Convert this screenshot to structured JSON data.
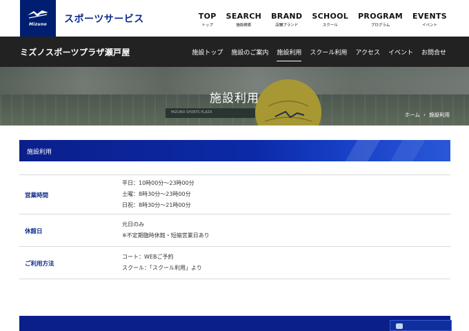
{
  "brand": {
    "logo_text": "Mizuno",
    "service_name": "スポーツサービス"
  },
  "global_nav": [
    {
      "en": "TOP",
      "ja": "トップ"
    },
    {
      "en": "SEARCH",
      "ja": "施設検索"
    },
    {
      "en": "BRAND",
      "ja": "店舗ブランド"
    },
    {
      "en": "SCHOOL",
      "ja": "スクール"
    },
    {
      "en": "PROGRAM",
      "ja": "プログラム"
    },
    {
      "en": "EVENTS",
      "ja": "イベント"
    }
  ],
  "facility_name": "ミズノスポーツプラザ瀬戸屋",
  "sub_nav": [
    {
      "label": "施設トップ"
    },
    {
      "label": "施設のご案内"
    },
    {
      "label": "施設利用",
      "active": true
    },
    {
      "label": "スクール利用"
    },
    {
      "label": "アクセス"
    },
    {
      "label": "イベント"
    },
    {
      "label": "お問合せ"
    }
  ],
  "hero": {
    "title": "施設利用",
    "board_text": "MIZUNO SPORTS PLAZA"
  },
  "breadcrumb": {
    "home": "ホーム",
    "separator": "›",
    "current": "施設利用"
  },
  "section": {
    "title": "施設利用"
  },
  "info_rows": [
    {
      "label": "営業時間",
      "lines": [
        "平日：10時00分〜23時00分",
        "土曜：8時30分〜23時00分",
        "日祝：8時30分〜21時00分"
      ]
    },
    {
      "label": "休館日",
      "lines": [
        "元日のみ",
        "※不定期臨時休館・短縮営業日あり"
      ]
    },
    {
      "label": "ご利用方法",
      "lines": [
        "コート：WEBご予約",
        "スクール：「スクール利用」より"
      ]
    }
  ],
  "colors": {
    "brand_blue": "#001e6f",
    "dark_bar": "#222222",
    "label_blue": "#0b2a8a"
  }
}
